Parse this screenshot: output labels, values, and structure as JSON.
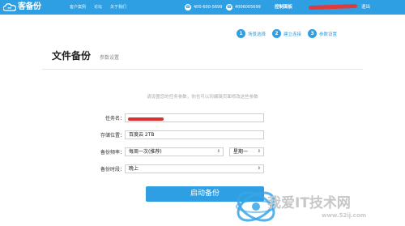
{
  "header": {
    "logo_text": "客备份",
    "nav": [
      "客户案例",
      "论坛",
      "关于我们"
    ],
    "phone1": "400-600-5699",
    "phone2": "4006005699",
    "console": "控制面板",
    "logout": "退出"
  },
  "steps": [
    {
      "num": "1",
      "label": "场景选择"
    },
    {
      "num": "2",
      "label": "建立连接"
    },
    {
      "num": "3",
      "label": "参数设置"
    }
  ],
  "page": {
    "title": "文件备份",
    "subtitle": "参数设置",
    "hint": "请设置您的任务参数，你也可以到编辑页面修改这些参数"
  },
  "form": {
    "task_name_label": "任务名：",
    "storage_label": "存储位置：",
    "storage_value": "百度云 2TB",
    "frequency_label": "备份频率：",
    "frequency_value": "每周一次(推荐)",
    "weekday_value": "星期一",
    "time_label": "备份时段：",
    "time_value": "晚上"
  },
  "start_button": "启动备份",
  "watermark": {
    "text": "我爱IT技术网",
    "url": "www.52ij.com"
  }
}
